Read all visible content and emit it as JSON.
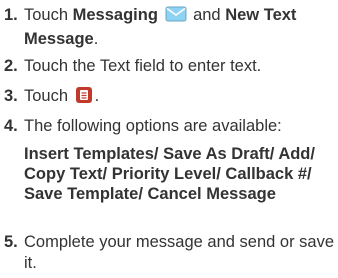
{
  "steps": [
    {
      "number": "1.",
      "text_before": "Touch ",
      "messaging_label": "Messaging",
      "messaging_icon": "envelope-icon",
      "text_and": " and ",
      "new_text_label": "New Text Message",
      "text_after": "."
    },
    {
      "number": "2.",
      "text": "Touch the Text field to enter text."
    },
    {
      "number": "3.",
      "text_before": "Touch ",
      "menu_icon": "menu-key-icon",
      "text_after": "."
    },
    {
      "number": "4.",
      "text": "The following options are available:",
      "options_text": "Insert Templates/ Save As Draft/ Add/ Copy Text/ Priority Level/ Callback #/ Save Template/ Cancel Message"
    },
    {
      "number": "5.",
      "text": "Complete your message and send or save it."
    }
  ],
  "colors": {
    "text": "#333333",
    "menu_icon_fill": "#c0392b",
    "envelope_fill": "#8fd3f4"
  }
}
